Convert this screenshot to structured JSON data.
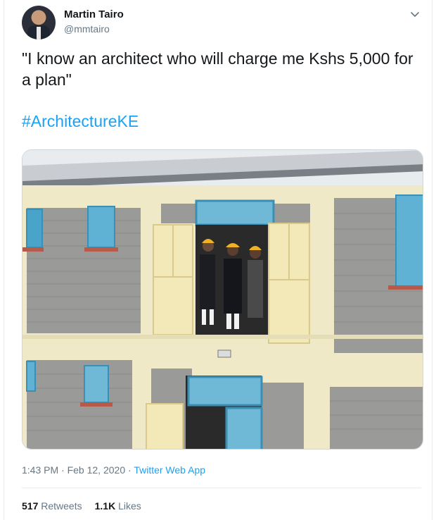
{
  "user": {
    "name": "Martin Tairo",
    "handle": "@mmtairo"
  },
  "tweet": {
    "text": "\"I know an architect who will charge me Kshs 5,000 for a plan\"",
    "hashtag": "#ArchitectureKE"
  },
  "meta": {
    "time": "1:43 PM",
    "separator1": " · ",
    "date": "Feb 12, 2020",
    "separator2": " · ",
    "app": "Twitter Web App"
  },
  "stats": {
    "retweets_count": "517",
    "retweets_label": "Retweets",
    "likes_count": "1.1K",
    "likes_label": "Likes"
  },
  "colors": {
    "link": "#1da1f2",
    "secondary_text": "#657786",
    "primary_text": "#14171a"
  },
  "icons": {
    "menu": "chevron-down-icon"
  }
}
